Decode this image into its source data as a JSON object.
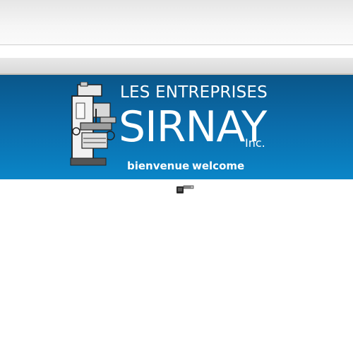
{
  "header": {
    "line1": "LES ENTREPRISES",
    "company": "SIRNAY",
    "suffix": "Inc."
  },
  "nav": {
    "items": [
      {
        "label": "bienvenue"
      },
      {
        "label": "welcome"
      }
    ]
  },
  "icons": {
    "logo": "milling-machine-icon",
    "below_banner": "caliper-tool-icon"
  },
  "colors": {
    "banner_top": "#0a5689",
    "banner_bottom": "#0a86c8",
    "text": "#ffffff"
  }
}
